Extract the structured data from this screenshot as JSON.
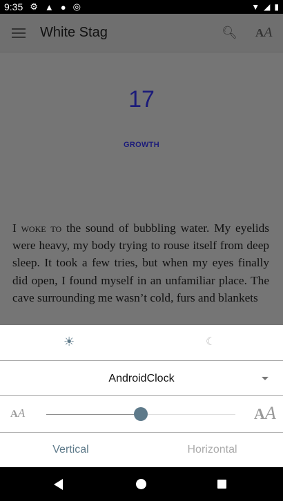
{
  "status_bar": {
    "time": "9:35"
  },
  "app_bar": {
    "title": "White Stag"
  },
  "chapter": {
    "number": "17",
    "name": "GROWTH",
    "text_smallcaps": "I woke to",
    "text": " the sound of bubbling water. My eyelids were heavy, my body trying to rouse itself from deep sleep. It took a few tries, but when my eyes finally did open, I found myself in an unfamiliar place. The cave sur­rounding me wasn’t cold, furs and blankets"
  },
  "settings": {
    "font_name": "AndroidClock",
    "font_size_percent": 50,
    "mode_vertical": "Vertical",
    "mode_horizontal": "Horizontal",
    "active_mode": "Vertical",
    "accent": "#5e7a8a"
  }
}
